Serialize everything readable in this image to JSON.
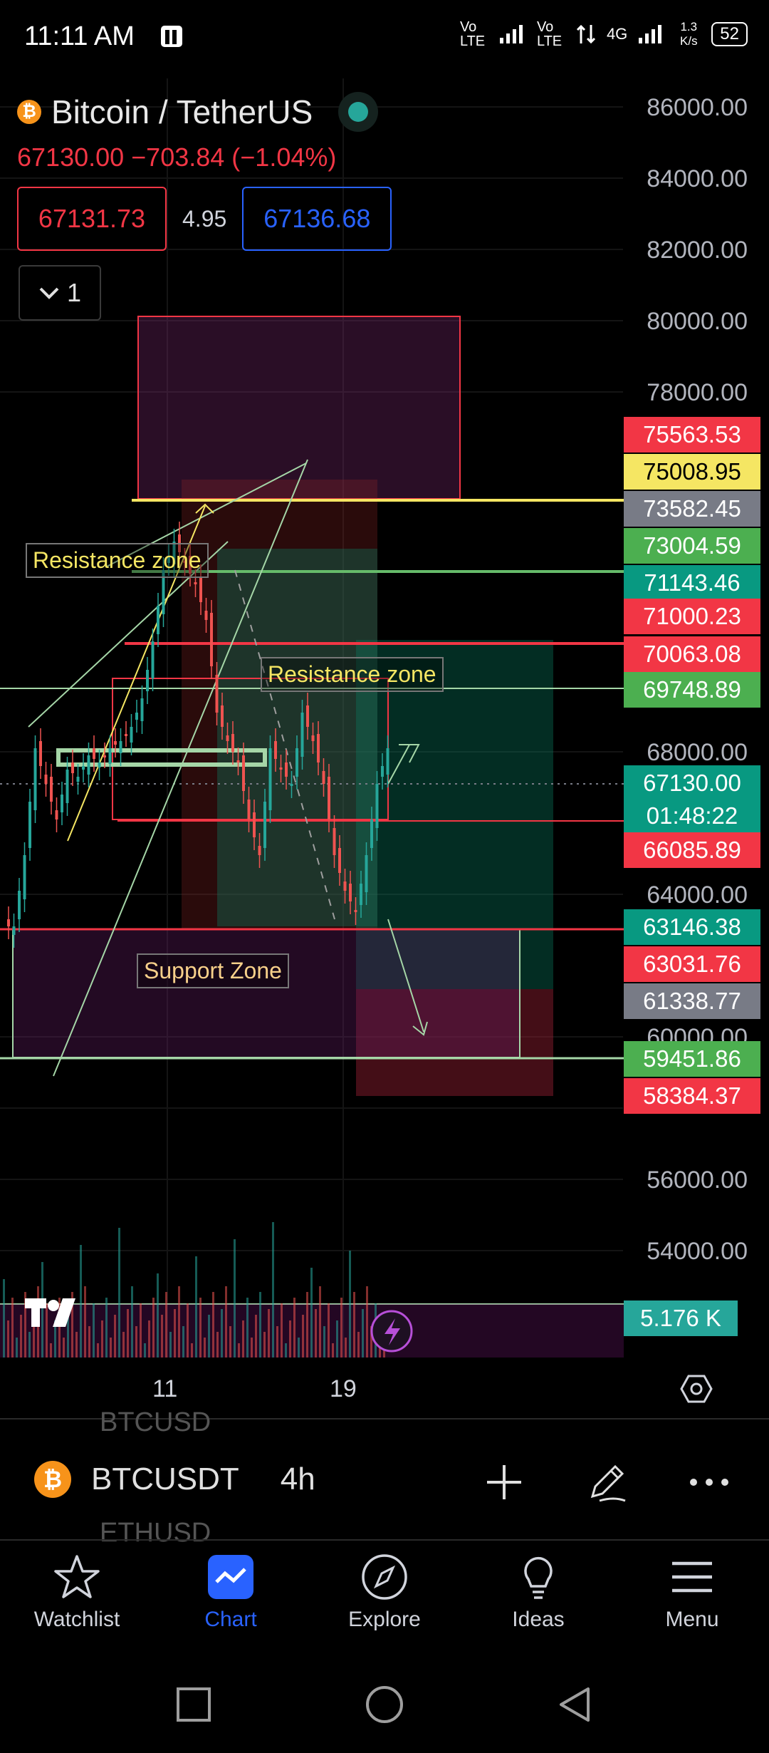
{
  "status_bar": {
    "time": "11:11 AM",
    "net1": "Vo LTE",
    "net2": "Vo LTE",
    "net3": "4G",
    "speed": "1.3 K/s",
    "battery": "52"
  },
  "header": {
    "title": "Bitcoin / TetherUS",
    "price_change": "67130.00  −703.84 (−1.04%)",
    "bid": "67131.73",
    "spread": "4.95",
    "ask": "67136.68",
    "layers_count": "1"
  },
  "price_axis": [
    "86000.00",
    "84000.00",
    "82000.00",
    "80000.00",
    "78000.00",
    "68000.00",
    "64000.00",
    "60000.00",
    "56000.00",
    "54000.00"
  ],
  "price_tags": [
    {
      "label": "75563.53",
      "color": "#f23645"
    },
    {
      "label": "75008.95",
      "color": "#f5e663",
      "dark": true
    },
    {
      "label": "73582.45",
      "color": "#787b86"
    },
    {
      "label": "73004.59",
      "color": "#4caf50"
    },
    {
      "label": "71143.46",
      "color": "#089981"
    },
    {
      "label": "71000.23",
      "color": "#f23645"
    },
    {
      "label": "70063.08",
      "color": "#f23645"
    },
    {
      "label": "69748.89",
      "color": "#4caf50"
    },
    {
      "label": "67130.00",
      "color": "#089981"
    },
    {
      "label": "01:48:22",
      "color": "#089981"
    },
    {
      "label": "66085.89",
      "color": "#f23645"
    },
    {
      "label": "63146.38",
      "color": "#089981"
    },
    {
      "label": "63031.76",
      "color": "#f23645"
    },
    {
      "label": "61338.77",
      "color": "#787b86"
    },
    {
      "label": "59451.86",
      "color": "#4caf50"
    },
    {
      "label": "58384.37",
      "color": "#f23645"
    },
    {
      "label": "5.176 K",
      "color": "#26a69a"
    }
  ],
  "annotations": {
    "resistance_1": "Resistance zone",
    "resistance_2": "Resistance zone",
    "support": "Support Zone"
  },
  "time_axis": [
    "11",
    "19"
  ],
  "symbol_toolbar": {
    "symbol": "BTCUSDT",
    "interval": "4h",
    "ghost_above": "BTCUSD",
    "ghost_below": "ETHUSD"
  },
  "nav": [
    {
      "label": "Watchlist"
    },
    {
      "label": "Chart"
    },
    {
      "label": "Explore"
    },
    {
      "label": "Ideas"
    },
    {
      "label": "Menu"
    }
  ],
  "logo_text": "TV"
}
